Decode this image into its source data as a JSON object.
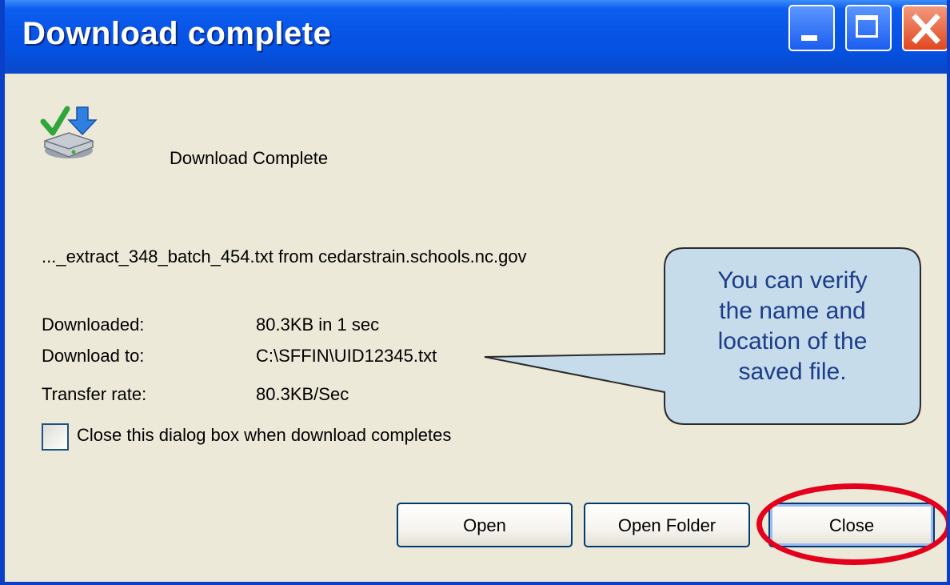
{
  "window": {
    "title": "Download complete",
    "controls": {
      "minimize_icon": "minimize-icon",
      "maximize_icon": "maximize-icon",
      "close_icon": "close-icon"
    }
  },
  "dialog": {
    "icon": "download-complete-icon",
    "heading": "Download Complete",
    "source": "..._extract_348_batch_454.txt from cedarstrain.schools.nc.gov",
    "details": {
      "downloaded_label": "Downloaded:",
      "downloaded_value": "80.3KB in 1 sec",
      "download_to_label": "Download to:",
      "download_to_value": "C:\\SFFIN\\UID12345.txt",
      "transfer_rate_label": "Transfer rate:",
      "transfer_rate_value": "80.3KB/Sec"
    },
    "checkbox": {
      "label": "Close this dialog box when download completes",
      "checked": false
    },
    "buttons": {
      "open": "Open",
      "open_folder": "Open Folder",
      "close": "Close"
    }
  },
  "annotation": {
    "callout_text": "You can verify\nthe name and\nlocation of the\nsaved file.",
    "callout_fill": "#c6dceb",
    "callout_text_color": "#1c3d8a",
    "highlight_color": "#e4001c"
  },
  "colors": {
    "titlebar": "#0754e6",
    "dialog_bg": "#ece9d8",
    "button_border": "#003c74"
  }
}
